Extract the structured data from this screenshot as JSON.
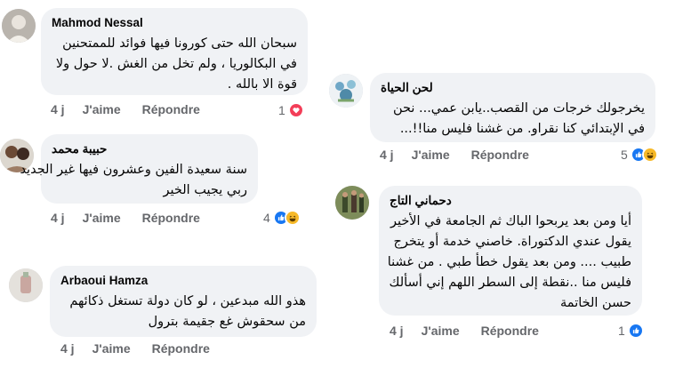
{
  "comments": [
    {
      "author": "Mahmod Nessal",
      "lines": [
        "سبحان الله حتى كورونا فيها فوائد للممتحنين",
        "في البكالوريا ، ولم تخل من الغش .لا حول ولا",
        "قوة الا بالله ."
      ],
      "time": "4 j",
      "like": "J'aime",
      "reply": "Répondre",
      "reaction_count": "1",
      "reactions": [
        "love-icon"
      ]
    },
    {
      "author": "حبيبة محمد",
      "lines": [
        "سنة سعيدة الفين وعشرون فيها غير الجديد",
        "ربي يجيب الخير"
      ],
      "time": "4 j",
      "like": "J'aime",
      "reply": "Répondre",
      "reaction_count": "4",
      "reactions": [
        "like-icon",
        "haha-icon"
      ]
    },
    {
      "author": "Arbaoui Hamza",
      "lines": [
        "هذو الله مبدعين ، لو كان دولة تستغل ذكائهم",
        "من سحقوش غع جقيمة بترول"
      ],
      "time": "4 j",
      "like": "J'aime",
      "reply": "Répondre",
      "reaction_count": "",
      "reactions": []
    },
    {
      "author": "لحن الحياة",
      "lines": [
        "يخرجولك خرجات من القصب..يابن عمي... نحن",
        "في الإبتدائي كنا نقراو. من غشنا فليس منا!!..."
      ],
      "time": "4 j",
      "like": "J'aime",
      "reply": "Répondre",
      "reaction_count": "5",
      "reactions": [
        "like-icon",
        "haha-icon"
      ]
    },
    {
      "author": "دحماني التاج",
      "lines": [
        "أيا ومن بعد يربحوا الباك ثم الجامعة في الأخير",
        "يقول عندي الدكتوراة.  خاصني خدمة أو يتخرج",
        "طبيب .... ومن بعد يقول خطأ طبي . من غشنا",
        "فليس منا ..نقطة إلى السطر اللهم إني أسألك",
        "حسن الخاتمة"
      ],
      "time": "4 j",
      "like": "J'aime",
      "reply": "Répondre",
      "reaction_count": "1",
      "reactions": [
        "like-icon"
      ]
    }
  ],
  "colors": {
    "bubble": "#f0f2f5",
    "meta_text": "#65676b",
    "like_blue": "#1877f2",
    "love_red": "#f33e58",
    "haha_yellow": "#f7b928"
  }
}
